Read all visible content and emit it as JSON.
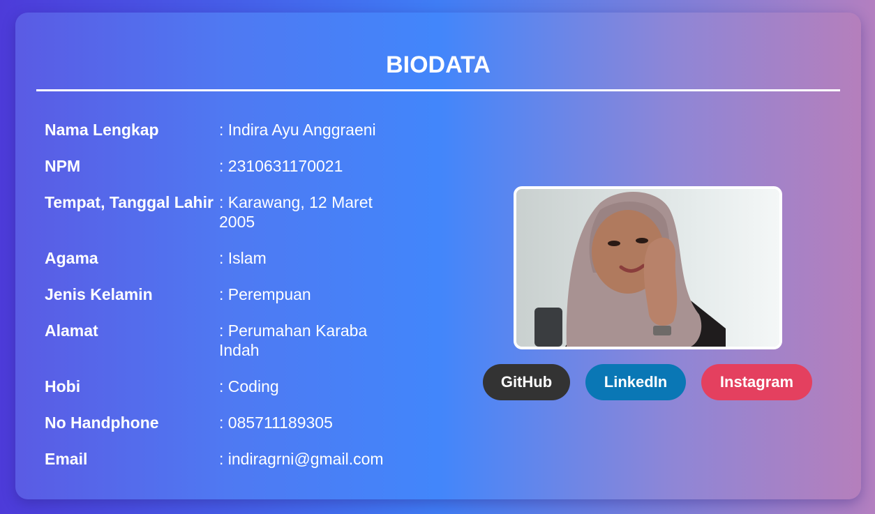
{
  "header": {
    "title": "BIODATA"
  },
  "biodata": [
    {
      "label": "Nama Lengkap",
      "value": ": Indira Ayu Anggraeni"
    },
    {
      "label": "NPM",
      "value": ": 2310631170021"
    },
    {
      "label": "Tempat, Tanggal Lahir",
      "value": ": Karawang, 12 Maret 2005"
    },
    {
      "label": "Agama",
      "value": ": Islam"
    },
    {
      "label": "Jenis Kelamin",
      "value": ": Perempuan"
    },
    {
      "label": "Alamat",
      "value": ": Perumahan Karaba Indah"
    },
    {
      "label": "Hobi",
      "value": ": Coding"
    },
    {
      "label": "No Handphone",
      "value": ": 085711189305"
    },
    {
      "label": "Email",
      "value": ": indiragrni@gmail.com"
    }
  ],
  "socials": {
    "github": {
      "label": "GitHub",
      "color": "#333333"
    },
    "linkedin": {
      "label": "LinkedIn",
      "color": "#0a77b5"
    },
    "instagram": {
      "label": "Instagram",
      "color": "#e4405f"
    }
  },
  "colors": {
    "background_start": "#4d3bd9",
    "background_mid": "#3f7df5",
    "background_end": "#b37fc0",
    "text": "#ffffff"
  }
}
